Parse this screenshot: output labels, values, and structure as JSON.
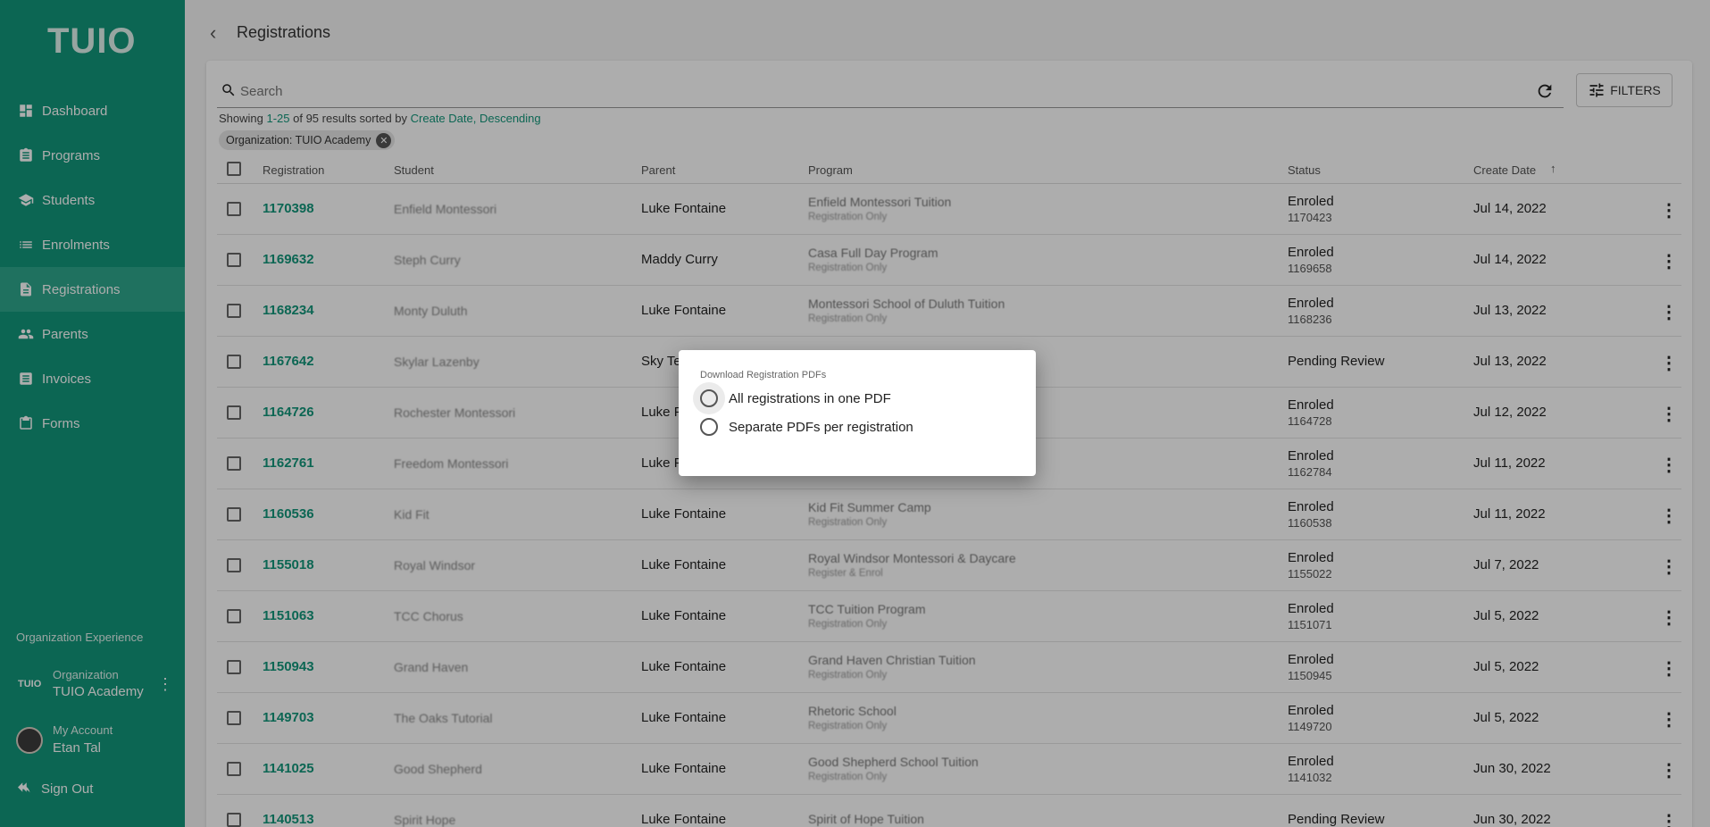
{
  "brand": {
    "logo_text": "TUIO",
    "mark_text": "TUIO"
  },
  "sidebar": {
    "items": [
      {
        "label": "Dashboard",
        "icon": "dashboard-icon"
      },
      {
        "label": "Programs",
        "icon": "clipboard-icon"
      },
      {
        "label": "Students",
        "icon": "school-icon"
      },
      {
        "label": "Enrolments",
        "icon": "list-icon"
      },
      {
        "label": "Registrations",
        "icon": "document-icon",
        "active": true
      },
      {
        "label": "Parents",
        "icon": "people-icon"
      },
      {
        "label": "Invoices",
        "icon": "invoice-icon"
      },
      {
        "label": "Forms",
        "icon": "clipboard-icon"
      }
    ],
    "org_experience_label": "Organization Experience",
    "org_label": "Organization",
    "org_name": "TUIO Academy",
    "account_label": "My Account",
    "account_name": "Etan Tal",
    "sign_out": "Sign Out"
  },
  "header": {
    "title": "Registrations"
  },
  "search": {
    "placeholder": "Search"
  },
  "filters_label": "FILTERS",
  "results": {
    "prefix": "Showing ",
    "range": "1-25",
    "middle": " of 95 results sorted by ",
    "sort_field": "Create Date",
    "comma": ", ",
    "sort_dir": "Descending"
  },
  "chip": {
    "label": "Organization: TUIO Academy"
  },
  "table": {
    "columns": [
      "Registration",
      "Student",
      "Parent",
      "Program",
      "Status",
      "Create Date"
    ],
    "rows": [
      {
        "id": "1170398",
        "student": "Enfield Montessori",
        "parent": "Luke Fontaine",
        "program": "Enfield Montessori Tuition",
        "program_sub": "Registration Only",
        "status": "Enroled",
        "status_sub": "1170423",
        "date": "Jul 14, 2022"
      },
      {
        "id": "1169632",
        "student": "Steph Curry",
        "parent": "Maddy Curry",
        "program": "Casa Full Day Program",
        "program_sub": "Registration Only",
        "status": "Enroled",
        "status_sub": "1169658",
        "date": "Jul 14, 2022"
      },
      {
        "id": "1168234",
        "student": "Monty Duluth",
        "parent": "Luke Fontaine",
        "program": "Montessori School of Duluth Tuition",
        "program_sub": "Registration Only",
        "status": "Enroled",
        "status_sub": "1168236",
        "date": "Jul 13, 2022"
      },
      {
        "id": "1167642",
        "student": "Skylar Lazenby",
        "parent": "Sky Tes",
        "program": "",
        "program_sub": "",
        "status": "Pending Review",
        "status_sub": "",
        "date": "Jul 13, 2022"
      },
      {
        "id": "1164726",
        "student": "Rochester Montessori",
        "parent": "Luke Fo",
        "program": "",
        "program_sub": "",
        "status": "Enroled",
        "status_sub": "1164728",
        "date": "Jul 12, 2022"
      },
      {
        "id": "1162761",
        "student": "Freedom Montessori",
        "parent": "Luke Fo",
        "program": "",
        "program_sub": "",
        "status": "Enroled",
        "status_sub": "1162784",
        "date": "Jul 11, 2022"
      },
      {
        "id": "1160536",
        "student": "Kid Fit",
        "parent": "Luke Fontaine",
        "program": "Kid Fit Summer Camp",
        "program_sub": "Registration Only",
        "status": "Enroled",
        "status_sub": "1160538",
        "date": "Jul 11, 2022"
      },
      {
        "id": "1155018",
        "student": "Royal Windsor",
        "parent": "Luke Fontaine",
        "program": "Royal Windsor Montessori & Daycare",
        "program_sub": "Register & Enrol",
        "status": "Enroled",
        "status_sub": "1155022",
        "date": "Jul 7, 2022"
      },
      {
        "id": "1151063",
        "student": "TCC Chorus",
        "parent": "Luke Fontaine",
        "program": "TCC Tuition Program",
        "program_sub": "Registration Only",
        "status": "Enroled",
        "status_sub": "1151071",
        "date": "Jul 5, 2022"
      },
      {
        "id": "1150943",
        "student": "Grand Haven",
        "parent": "Luke Fontaine",
        "program": "Grand Haven Christian Tuition",
        "program_sub": "Registration Only",
        "status": "Enroled",
        "status_sub": "1150945",
        "date": "Jul 5, 2022"
      },
      {
        "id": "1149703",
        "student": "The Oaks Tutorial",
        "parent": "Luke Fontaine",
        "program": "Rhetoric School",
        "program_sub": "Registration Only",
        "status": "Enroled",
        "status_sub": "1149720",
        "date": "Jul 5, 2022"
      },
      {
        "id": "1141025",
        "student": "Good Shepherd",
        "parent": "Luke Fontaine",
        "program": "Good Shepherd School Tuition",
        "program_sub": "Registration Only",
        "status": "Enroled",
        "status_sub": "1141032",
        "date": "Jun 30, 2022"
      },
      {
        "id": "1140513",
        "student": "Spirit Hope",
        "parent": "Luke Fontaine",
        "program": "Spirit of Hope Tuition",
        "program_sub": "",
        "status": "Pending Review",
        "status_sub": "",
        "date": "Jun 30, 2022"
      }
    ]
  },
  "dialog": {
    "title": "Download Registration PDFs",
    "option_all": "All registrations in one PDF",
    "option_separate": "Separate PDFs per registration"
  }
}
